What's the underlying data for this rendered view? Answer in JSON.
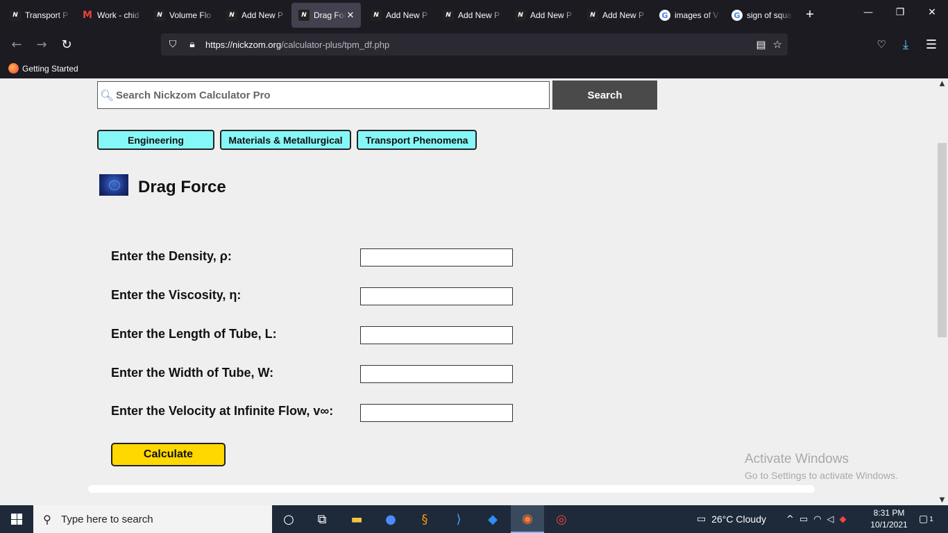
{
  "browser": {
    "tabs": [
      {
        "title": "Transport P",
        "favicon": "nickzom-icon",
        "active": false
      },
      {
        "title": "Work - chid",
        "favicon": "gmail-icon",
        "active": false
      },
      {
        "title": "Volume Flo",
        "favicon": "nickzom-icon",
        "active": false
      },
      {
        "title": "Add New P",
        "favicon": "nickzom-icon",
        "active": false
      },
      {
        "title": "Drag For",
        "favicon": "nickzom-icon",
        "active": true
      },
      {
        "title": "Add New P",
        "favicon": "nickzom-icon",
        "active": false
      },
      {
        "title": "Add New P",
        "favicon": "nickzom-icon",
        "active": false
      },
      {
        "title": "Add New P",
        "favicon": "nickzom-icon",
        "active": false
      },
      {
        "title": "Add New P",
        "favicon": "nickzom-icon",
        "active": false
      },
      {
        "title": "images of V",
        "favicon": "google-icon",
        "active": false
      },
      {
        "title": "sign of squa",
        "favicon": "google-icon",
        "active": false
      }
    ],
    "url_host": "https://nickzom.org",
    "url_path": "/calculator-plus/tpm_df.php",
    "bookmark": "Getting Started"
  },
  "page": {
    "search": {
      "placeholder": "Search Nickzom Calculator Pro",
      "button": "Search"
    },
    "categories": [
      "Engineering",
      "Materials & Metallurgical",
      "Transport Phenomena"
    ],
    "title": "Drag Force",
    "fields": [
      {
        "label": "Enter the Density, ρ:",
        "value": ""
      },
      {
        "label": "Enter the Viscosity, η:",
        "value": ""
      },
      {
        "label": "Enter the Length of Tube, L:",
        "value": ""
      },
      {
        "label": "Enter the Width of Tube, W:",
        "value": ""
      },
      {
        "label": "Enter the Velocity at Infinite Flow, v∞:",
        "value": ""
      }
    ],
    "calculate": "Calculate"
  },
  "watermark": {
    "line1": "Activate Windows",
    "line2": "Go to Settings to activate Windows."
  },
  "taskbar": {
    "search_placeholder": "Type here to search",
    "weather": "26°C  Cloudy",
    "time": "8:31 PM",
    "date": "10/1/2021",
    "notifications": "1"
  }
}
